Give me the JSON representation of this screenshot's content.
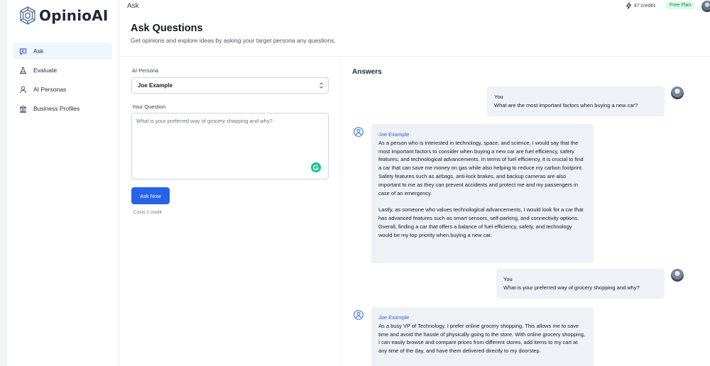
{
  "app": {
    "name": "OpinioAI",
    "header_title": "Ask",
    "credits": "47 credits",
    "plan": "Free Plan"
  },
  "sidebar": {
    "items": [
      {
        "label": "Ask",
        "icon": "chat-icon",
        "active": true
      },
      {
        "label": "Evaluate",
        "icon": "flask-icon"
      },
      {
        "label": "AI Personas",
        "icon": "user-icon"
      },
      {
        "label": "Business Profiles",
        "icon": "building-icon"
      }
    ]
  },
  "page": {
    "title": "Ask Questions",
    "subtitle": "Get opinions and explore ideas by asking your target persona any questions."
  },
  "form": {
    "persona_label": "AI Persona",
    "persona_value": "Joe Example",
    "question_label": "Your Question",
    "question_placeholder": "What is your preferred way of grocery shopping and why?",
    "ask_button": "Ask Now",
    "cost_note": "Costs 1 credit"
  },
  "answers": {
    "title": "Answers",
    "messages": [
      {
        "role": "user",
        "name": "You",
        "text": "What are the most important factors when buying a new car?"
      },
      {
        "role": "ai",
        "name": "Joe Example",
        "paragraphs": [
          "As a person who is interested in technology, space, and science, I would say that the most important factors to consider when buying a new car are fuel efficiency, safety features, and technological advancements. In terms of fuel efficiency, it is crucial to find a car that can save me money on gas while also helping to reduce my carbon footprint. Safety features such as airbags, anti-lock brakes, and backup cameras are also important to me as they can prevent accidents and protect me and my passengers in case of an emergency.",
          "Lastly, as someone who values technological advancements, I would look for a car that has advanced features such as smart sensors, self-parking, and connectivity options. Overall, finding a car that offers a balance of fuel efficiency, safety, and technology would be my top priority when buying a new car."
        ]
      },
      {
        "role": "user",
        "name": "You",
        "text": "What is your preferred way of grocery shopping and why?"
      },
      {
        "role": "ai",
        "name": "Joe Example",
        "paragraphs": [
          "As a busy VP of Technology, I prefer online grocery shopping. This allows me to save time and avoid the hassle of physically going to the store. With online grocery shopping, I can easily browse and compare prices from different stores, add items to my cart at any time of the day, and have them delivered directly to my doorstep."
        ]
      }
    ]
  },
  "colors": {
    "accent": "#2563eb",
    "active_nav_bg": "#eff6ff",
    "bubble_bg": "#eef1f5",
    "plan_badge_bg": "#dcfce7",
    "plan_badge_text": "#15803d"
  }
}
